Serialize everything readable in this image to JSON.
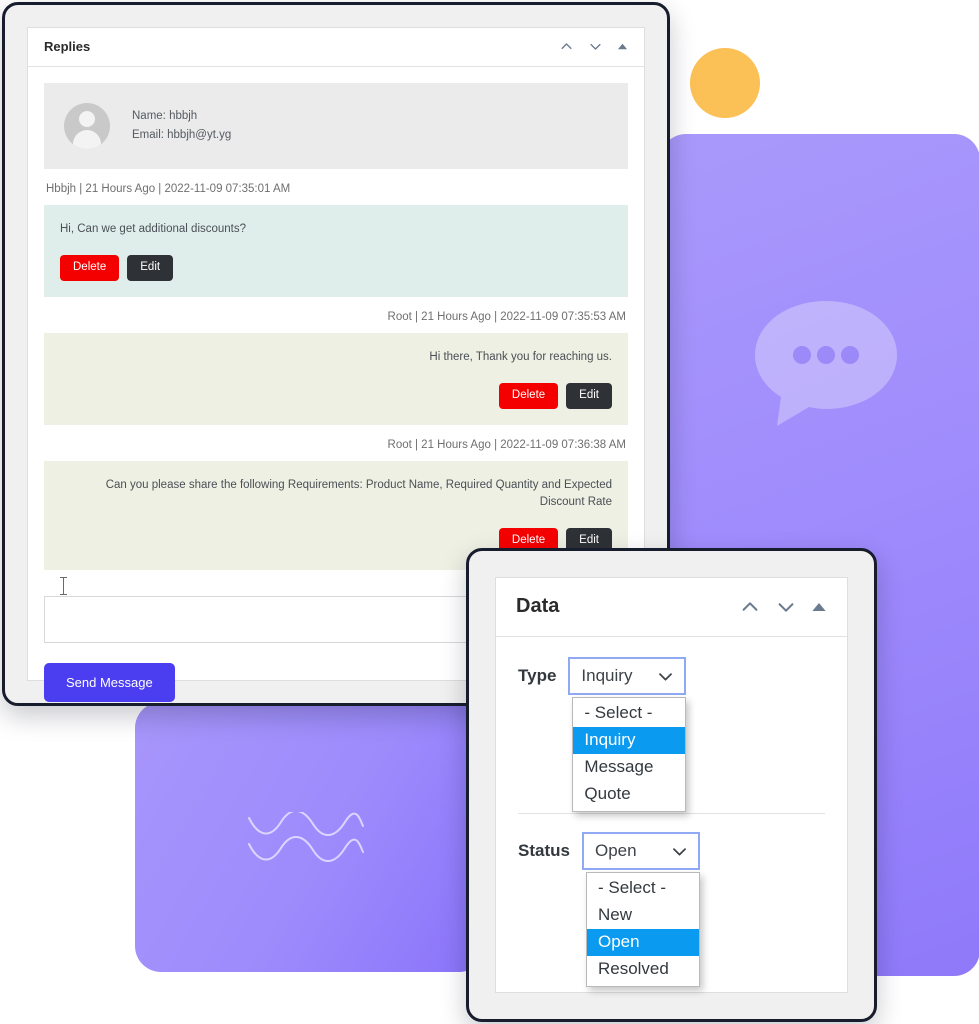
{
  "theme": {
    "accent_purple": "#4b3ef0",
    "deco_purple": "#a08cfc",
    "deco_yellow": "#fbc156",
    "delete_red": "#f50000",
    "edit_dark": "#2e3135",
    "highlight_blue": "#0a9bf0",
    "mint_bubble": "#e0eeeb",
    "olive_bubble": "#eef0e4"
  },
  "replies_window": {
    "title": "Replies",
    "header_icons": [
      "chevron-up-icon",
      "chevron-down-icon",
      "triangle-up-icon"
    ],
    "profile": {
      "name_line": "Name: hbbjh",
      "email_line": "Email: hbbjh@yt.yg",
      "avatar": "user-avatar-icon"
    },
    "messages": [
      {
        "meta": "Hbbjh | 21 Hours Ago | 2022-11-09 07:35:01 AM",
        "meta_align": "left",
        "text": "Hi, Can we get additional discounts?",
        "align": "left",
        "bubble": "mint",
        "delete_label": "Delete",
        "edit_label": "Edit"
      },
      {
        "meta": "Root | 21 Hours Ago | 2022-11-09 07:35:53 AM",
        "meta_align": "right",
        "text": "Hi there, Thank you for reaching us.",
        "align": "right",
        "bubble": "olive",
        "delete_label": "Delete",
        "edit_label": "Edit"
      },
      {
        "meta": "Root | 21 Hours Ago | 2022-11-09 07:36:38 AM",
        "meta_align": "right",
        "text": "Can you please share the following Requirements: Product Name, Required Quantity and Expected Discount Rate",
        "align": "right",
        "bubble": "olive",
        "delete_label": "Delete",
        "edit_label": "Edit"
      }
    ],
    "composer": {
      "value": "",
      "placeholder": "",
      "send_label": "Send Message"
    }
  },
  "data_window": {
    "title": "Data",
    "header_icons": [
      "chevron-up-icon",
      "chevron-down-icon",
      "triangle-up-icon"
    ],
    "fields": [
      {
        "label": "Type",
        "selected": "Inquiry",
        "open": true,
        "options": [
          "- Select -",
          "Inquiry",
          "Message",
          "Quote"
        ]
      },
      {
        "label": "Status",
        "selected": "Open",
        "open": true,
        "options": [
          "- Select -",
          "New",
          "Open",
          "Resolved"
        ]
      }
    ]
  },
  "decorations": {
    "circle": "yellow-circle",
    "right_card_icon": "chat-bubble-icon",
    "left_card_icon": "wave-lines-icon"
  }
}
